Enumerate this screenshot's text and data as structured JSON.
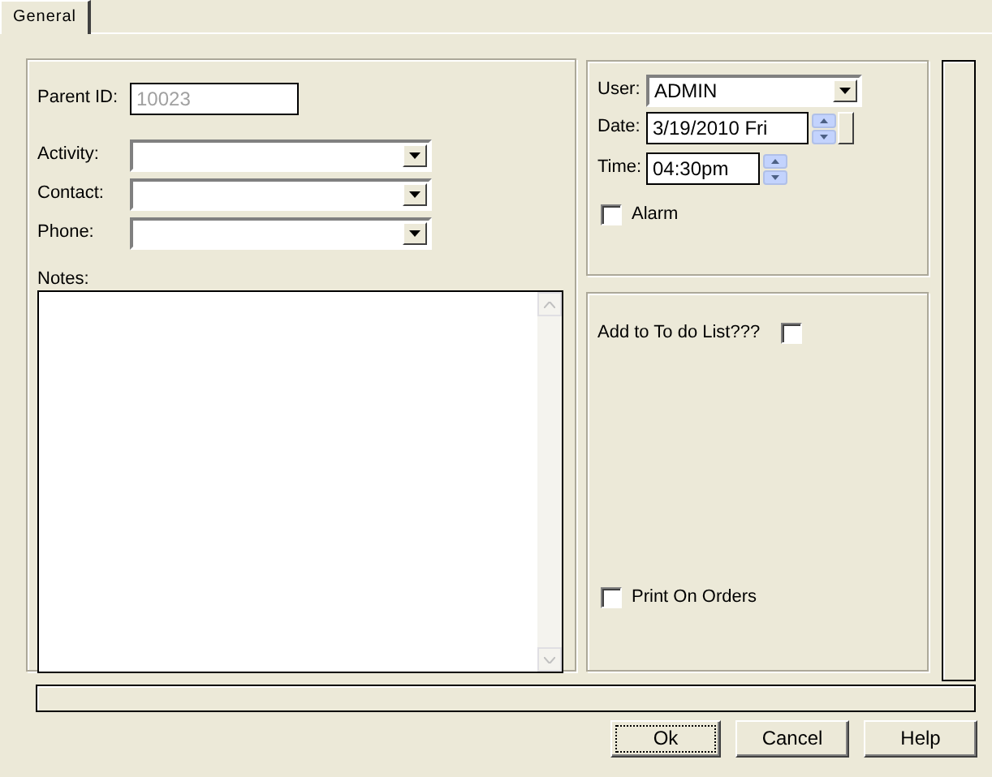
{
  "tabs": [
    {
      "label": "General",
      "selected": true
    }
  ],
  "left": {
    "parent_id": {
      "label": "Parent ID:",
      "value": "10023",
      "disabled": true
    },
    "combos": [
      {
        "label": "Activity:"
      },
      {
        "label": "Contact:"
      },
      {
        "label": "Phone:"
      }
    ],
    "notes": {
      "label": "Notes:"
    }
  },
  "schedule": {
    "user": {
      "label": "User:",
      "value": "ADMIN"
    },
    "date": {
      "label": "Date:",
      "value": "3/19/2010 Fri"
    },
    "time": {
      "label": "Time:",
      "value": "04:30pm"
    },
    "alarm": {
      "label": "Alarm",
      "checked": false
    }
  },
  "options": [
    {
      "label": "Add to To do List???",
      "checked": false,
      "kind": "trailing"
    },
    {
      "label": "Print On Orders",
      "checked": false,
      "kind": "leading"
    }
  ],
  "buttons": [
    {
      "label": "Ok",
      "focused": true
    },
    {
      "label": "Cancel",
      "focused": false
    },
    {
      "label": "Help",
      "focused": false
    }
  ]
}
